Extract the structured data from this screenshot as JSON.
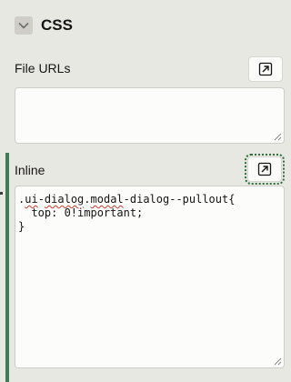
{
  "section": {
    "title": "CSS",
    "collapse_icon": "chevron-down-icon"
  },
  "file_urls": {
    "label": "File URLs",
    "value": "",
    "expand_icon": "expand-dialog-icon"
  },
  "inline": {
    "label": "Inline",
    "expand_icon": "expand-dialog-icon",
    "code_line1_part1": ".",
    "code_line1_ui": "ui",
    "code_line1_dash1": "-",
    "code_line1_dialog": "dialog",
    "code_line1_dot": ".",
    "code_line1_modal": "modal",
    "code_line1_rest": "-dialog--pullout{",
    "code_line2": "  top: 0!important;",
    "code_line3": "}"
  },
  "colors": {
    "accent": "#3f7b55",
    "background": "#e8e8e3",
    "spellcheck": "#d23a2e"
  }
}
